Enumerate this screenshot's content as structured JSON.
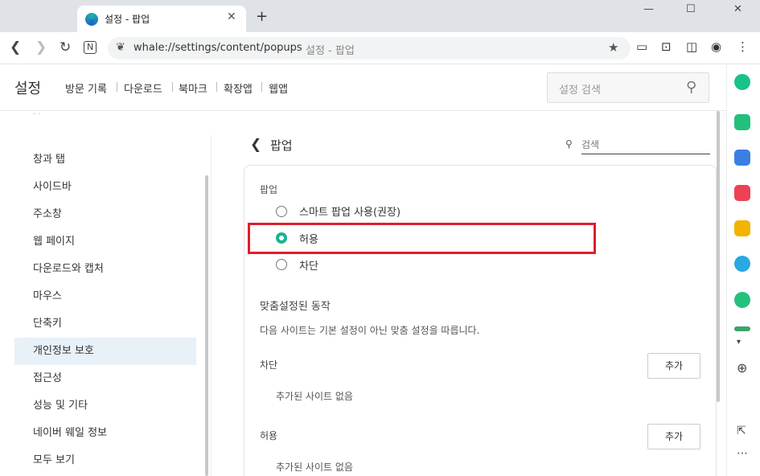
{
  "browser": {
    "tab_title": "설정 - 팝업",
    "tab_close": "✕",
    "new_tab": "+",
    "window_controls": {
      "minimize": "—",
      "maximize": "☐",
      "close": "✕"
    },
    "url": "whale://settings/content/popups",
    "url_title": "설정 - 팝업"
  },
  "header": {
    "brand": "설정",
    "nav": [
      "방문 기록",
      "다운로드",
      "북마크",
      "확장앱",
      "웹앱"
    ],
    "search_placeholder": "설정 검색"
  },
  "sidebar": {
    "items": [
      {
        "label": "창과 탭"
      },
      {
        "label": "사이드바"
      },
      {
        "label": "주소창"
      },
      {
        "label": "웹 페이지"
      },
      {
        "label": "다운로드와 캡처"
      },
      {
        "label": "마우스"
      },
      {
        "label": "단축키"
      },
      {
        "label": "개인정보 보호",
        "active": true
      },
      {
        "label": "접근성"
      },
      {
        "label": "성능 및 기타"
      },
      {
        "label": "네이버 웨일 정보"
      },
      {
        "label": "모두 보기"
      }
    ]
  },
  "content": {
    "title": "팝업",
    "search_placeholder": "검색",
    "section_label": "팝업",
    "options": [
      {
        "label": "스마트 팝업 사용(권장)",
        "selected": false
      },
      {
        "label": "허용",
        "selected": true
      },
      {
        "label": "차단",
        "selected": false
      }
    ],
    "custom_heading": "맞춤설정된 동작",
    "custom_desc": "다음 사이트는 기본 설정이 아닌 맞춤 설정을 따릅니다.",
    "block_label": "차단",
    "block_add": "추가",
    "block_empty": "추가된 사이트 없음",
    "allow_label": "허용",
    "allow_add": "추가",
    "allow_empty": "추가된 사이트 없음"
  },
  "colors": {
    "accent": "#18b394",
    "highlight": "#e01e2c",
    "active_bg": "#e8f0f8"
  }
}
